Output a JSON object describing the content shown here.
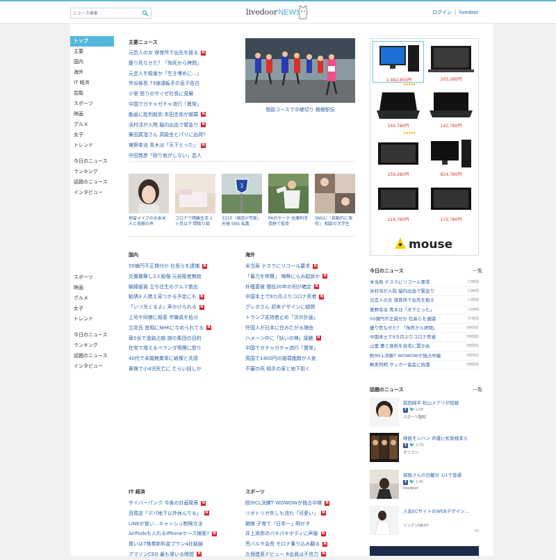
{
  "header": {
    "search_placeholder": "ニュース検索",
    "logo_main": "livedoor",
    "logo_news": "NEWS",
    "login_label": "ログイン",
    "separator": "|",
    "livedoor_link": "livedoor"
  },
  "nav": {
    "items": [
      "トップ",
      "主要",
      "国内",
      "海外",
      "IT 経済",
      "芸能",
      "スポーツ",
      "映画",
      "グルメ",
      "女子",
      "トレンド"
    ],
    "extra": [
      "今日のニュース",
      "ランキング",
      "話題のニュース",
      "インタビュー"
    ],
    "items2": [
      "スポーツ",
      "映画",
      "グルメ",
      "女子",
      "トレンド"
    ],
    "extra2": [
      "今日のニュース",
      "ランキング",
      "話題のニュース",
      "インタビュー"
    ]
  },
  "main": {
    "title": "主要ニュース",
    "items": [
      {
        "text": "元恋人の女 保育所で出先を殺る",
        "new": true
      },
      {
        "text": "腹り死なせた？「殉死から拷問」",
        "new": false
      },
      {
        "text": "元恋人を殺害か「生き埋めに…」",
        "new": false
      },
      {
        "text": "宗谷部長 73億運転手の息子告白",
        "new": false
      },
      {
        "text": "小室 怒りのサイゼ社長に見解",
        "new": false
      },
      {
        "text": "中国でガチャガチャ流行「異常」",
        "new": false
      },
      {
        "text": "動画に批判殺到 本田圭佑が謝罪",
        "new": true
      },
      {
        "text": "浜村淳が入院 脳内出血で緊急り",
        "new": true
      },
      {
        "text": "桑田真澄さん 高級虫とパリに出荷?",
        "new": false
      },
      {
        "text": "東野幸治 青木は「天下とった」",
        "new": true
      },
      {
        "text": "中田敦彦「殴り気がしない」芸人",
        "new": false
      }
    ],
    "hero_caption": "復路コースで中継切り 箱根駅伝"
  },
  "thumbs": [
    {
      "caption": "地雷メイクのお本見 人と見解の声"
    },
    {
      "caption": "コロナで隔離生活 1ヶ月以下 間取り図"
    },
    {
      "caption": "3310「国道が可能」 天候 SNS 拡散"
    },
    {
      "caption": "PAのヤーデ 佐藤利幸 長野で投資"
    },
    {
      "caption": "SNSに「自動的に保存」 相談の大学生"
    }
  ],
  "domestic": {
    "title": "国内",
    "items": [
      {
        "text": "50億円不正貸付か 社長らを逮捕",
        "new": true
      },
      {
        "text": "交番襲撃し2人殺傷 元自衛官無給",
        "new": false
      },
      {
        "text": "朝緑部員 立ち往生のクルマ救出",
        "new": false
      },
      {
        "text": "勧誘3 人携え見つかる予定にも",
        "new": true
      },
      {
        "text": "「いつ児くるよ」声かけられる",
        "new": true
      },
      {
        "text": "上司や同僚に殺意 市職員を処分",
        "new": false
      },
      {
        "text": "立花氏 首相にNHKになめられてる",
        "new": true
      },
      {
        "text": "車5台で道路占拠 謎の集団の目的",
        "new": false
      },
      {
        "text": "在宅で増えるベランダ喫煙に怒り",
        "new": false
      },
      {
        "text": "40代で未婚無業率に戦慄と共感",
        "new": false
      },
      {
        "text": "車検で小4児死亡に たらい回しか",
        "new": false
      }
    ]
  },
  "overseas": {
    "title": "海外",
    "items": [
      {
        "text": "米当局 テスラにリコール要求",
        "new": true
      },
      {
        "text": "「暴力を称賛」 侮辱にらみ起訴か",
        "new": true
      },
      {
        "text": "朴槿恵被 懲役20年の刑が確定",
        "new": true
      },
      {
        "text": "中国本土で9カ月ぶりコロナ死者",
        "new": true
      },
      {
        "text": "グレタさん 初来デザインに疑問",
        "new": false
      },
      {
        "text": "トランプ支持者止め「次の計画」",
        "new": false
      },
      {
        "text": "外国人が日本に住みたがる理由",
        "new": false
      },
      {
        "text": "ハメーン中に「妖いの神」接触",
        "new": true
      },
      {
        "text": "中国でガチャガチャ流行「異常」",
        "new": false
      },
      {
        "text": "英国で1400円の謝罪胞数が人気",
        "new": false
      },
      {
        "text": "不審の死 相手の家と地下駐く",
        "new": false
      }
    ]
  },
  "it": {
    "title": "IT 経済",
    "items": [
      {
        "text": "サイバーパンク 今後の計画発表",
        "new": true
      },
      {
        "text": "百貨店「デパ地下以外休んでる」",
        "new": true
      },
      {
        "text": "LINEが宣い…キャッシュ制限方法",
        "new": false
      },
      {
        "text": "AirPodsも入れるiPhoneケース検索?",
        "new": true
      },
      {
        "text": "買いは7株券新料金プラン4社結論",
        "new": false
      },
      {
        "text": "アマゾンCEO 最も偉いる時間",
        "new": true
      }
    ]
  },
  "sports": {
    "title": "スポーツ",
    "items": [
      {
        "text": "欧州CL決勝T WOWOWが独占中継",
        "new": true
      },
      {
        "text": "リボトリガ失しも流れ「可愛い」",
        "new": true
      },
      {
        "text": "箱根 子育て「日本一」明かす",
        "new": false
      },
      {
        "text": "井上尚弥のパキパキボディに声援",
        "new": true
      },
      {
        "text": "荒バルサ会長 モロナ乗り込み翻る",
        "new": true
      },
      {
        "text": "久保建英デビュー R会員は不信力",
        "new": true
      }
    ]
  },
  "ad": {
    "prices": [
      "1,482,800円",
      "203,280円",
      "142,780円",
      "142,780円",
      "159,280円",
      "824,780円",
      "219,780円",
      "175,780円"
    ],
    "brand": "mouse",
    "stars": "★★★★★",
    "info_mark": "i"
  },
  "today": {
    "title": "今日のニュース",
    "more": "一覧",
    "items": [
      {
        "text": "米当局 テスラにリコール要求",
        "time": "13時間"
      },
      {
        "text": "浜村淳が入院 脳内出血で緊急り",
        "time": "13時間"
      },
      {
        "text": "元恋人の女 保育所で出先を殺る",
        "time": "13時間"
      },
      {
        "text": "東野幸治 青木は「天下とった」",
        "time": "13時間"
      },
      {
        "text": "50億円不正貸付か 社長らを逮捕",
        "time": "37時間"
      },
      {
        "text": "腹り死なせた？「殉死から拷問」",
        "time": "3時間前"
      },
      {
        "text": "中国本土で9カ月ぶりコロナ死者",
        "time": "3時間前"
      },
      {
        "text": "山里 妻と真剣を自宅に置かぬ",
        "time": "3時間前"
      },
      {
        "text": "欧州CL決勝T WOWOWが独占中継",
        "time": "3時間前"
      },
      {
        "text": "無実判明 サッカー協会に抗議",
        "time": "3時間前"
      }
    ]
  },
  "topics": {
    "title": "話題のニュース",
    "more": "一覧",
    "items": [
      {
        "title": "前田純平 松山メアリが結婚",
        "fb": "f",
        "count": "1/08",
        "src": "スポーツ報知",
        "pr": ""
      },
      {
        "title": "映画モンハン 声優に松坂桃李ら",
        "fb": "f",
        "count": "1/79",
        "src": "オリコン",
        "pr": ""
      },
      {
        "title": "保阪さんの日輪分 1/1で普通",
        "fb": "f",
        "count": "1/40",
        "src": "livedoor",
        "pr": ""
      },
      {
        "title": "人気ECサイトのWEBデザイン…",
        "fb": "",
        "count": "",
        "src": "リンデジNEXT",
        "pr": "PR"
      }
    ]
  }
}
